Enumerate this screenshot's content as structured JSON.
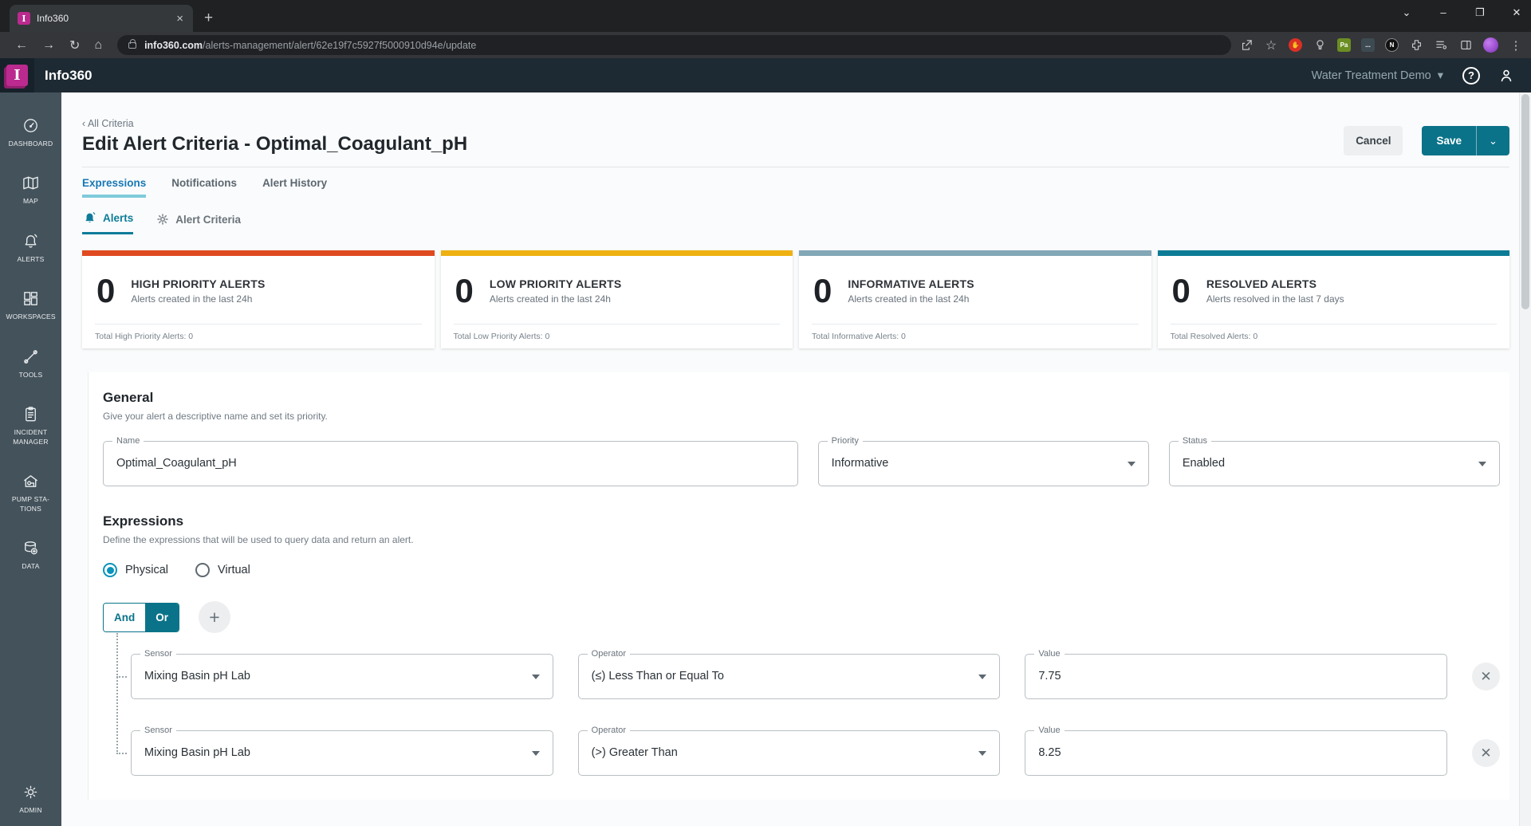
{
  "colors": {
    "teal_primary": "#0B7389",
    "teal_link": "#0E7C99",
    "tab_active_blue": "#1779B5",
    "brand_magenta": "#BB2A8E",
    "high_priority": "#E04A21",
    "low_priority": "#EEB111",
    "informative": "#82A7B7",
    "resolved": "#0C7B96"
  },
  "browser": {
    "tab_title": "Info360",
    "favicon_letter": "I",
    "tab_close_glyph": "×",
    "new_tab_glyph": "+",
    "back_glyph": "←",
    "forward_glyph": "→",
    "reload_glyph": "↻",
    "home_glyph": "⌂",
    "url_domain": "info360.com",
    "url_path": "/alerts-management/alert/62e19f7c5927f5000910d94e/update",
    "extension_pa_label": "Pa",
    "extension_dots_label": "...",
    "extension_n_label": "N",
    "menu_glyph": "⋮",
    "window_chevron_glyph": "⌄",
    "minimize_glyph": "–",
    "restore_glyph": "❐",
    "close_glyph": "✕"
  },
  "app_header": {
    "brand": "Info360",
    "brand_initial": "I",
    "workspace": "Water Treatment Demo",
    "chevron_glyph": "▾",
    "help_glyph": "?"
  },
  "sidebar": {
    "items": [
      {
        "label": "DASHBOARD"
      },
      {
        "label": "MAP"
      },
      {
        "label": "ALERTS"
      },
      {
        "label": "WORKSPACES"
      },
      {
        "label": "TOOLS"
      },
      {
        "label": "INCIDENT MANAGER"
      },
      {
        "label": "PUMP STA-TIONS"
      },
      {
        "label": "DATA"
      }
    ],
    "admin_label": "ADMIN"
  },
  "page": {
    "breadcrumb_chevron": "‹",
    "breadcrumb": "All Criteria",
    "title": "Edit Alert Criteria - Optimal_Coagulant_pH",
    "cancel_label": "Cancel",
    "save_label": "Save",
    "save_menu_glyph": "⌄",
    "tabs": [
      {
        "label": "Expressions"
      },
      {
        "label": "Notifications"
      },
      {
        "label": "Alert History"
      }
    ],
    "subtabs": [
      {
        "label": "Alerts"
      },
      {
        "label": "Alert Criteria"
      }
    ]
  },
  "summary_cards": [
    {
      "count": "0",
      "title": "HIGH PRIORITY ALERTS",
      "subtitle": "Alerts created in the last 24h",
      "footer": "Total High Priority Alerts: 0",
      "color": "#E04A21"
    },
    {
      "count": "0",
      "title": "LOW PRIORITY ALERTS",
      "subtitle": "Alerts created in the last 24h",
      "footer": "Total Low Priority Alerts: 0",
      "color": "#EEB111"
    },
    {
      "count": "0",
      "title": "INFORMATIVE ALERTS",
      "subtitle": "Alerts created in the last 24h",
      "footer": "Total Informative Alerts: 0",
      "color": "#82A7B7"
    },
    {
      "count": "0",
      "title": "RESOLVED ALERTS",
      "subtitle": "Alerts resolved in the last 7 days",
      "footer": "Total Resolved Alerts: 0",
      "color": "#0C7B96"
    }
  ],
  "general": {
    "heading": "General",
    "subtitle": "Give your alert a descriptive name and set its priority.",
    "name_label": "Name",
    "name_value": "Optimal_Coagulant_pH",
    "priority_label": "Priority",
    "priority_value": "Informative",
    "status_label": "Status",
    "status_value": "Enabled"
  },
  "expressions": {
    "heading": "Expressions",
    "subtitle": "Define the expressions that will be used to query data and return an alert.",
    "radio_physical": "Physical",
    "radio_virtual": "Virtual",
    "and_label": "And",
    "or_label": "Or",
    "plus_glyph": "+",
    "remove_glyph": "✕",
    "rows": [
      {
        "sensor_label": "Sensor",
        "sensor_value": "Mixing Basin pH Lab",
        "operator_label": "Operator",
        "operator_value": "(≤) Less Than or Equal To",
        "value_label": "Value",
        "value": "7.75"
      },
      {
        "sensor_label": "Sensor",
        "sensor_value": "Mixing Basin pH Lab",
        "operator_label": "Operator",
        "operator_value": "(>) Greater Than",
        "value_label": "Value",
        "value": "8.25"
      }
    ]
  }
}
